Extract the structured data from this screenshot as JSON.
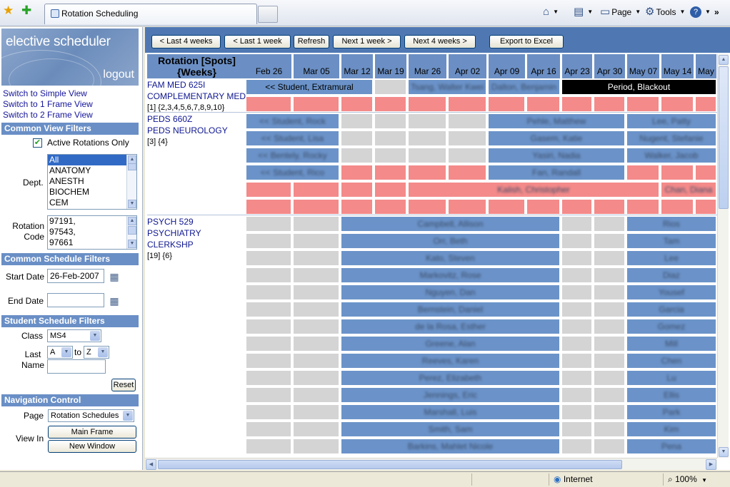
{
  "browser": {
    "tab_title": "Rotation Scheduling",
    "commands": {
      "page": "Page",
      "tools": "Tools"
    }
  },
  "left": {
    "brand_title": "elective scheduler",
    "logout": "logout",
    "links": [
      "Switch to Simple View",
      "Switch to 1 Frame View",
      "Switch to 2 Frame View"
    ],
    "sections": {
      "common_view": "Common View Filters",
      "common_schedule": "Common Schedule Filters",
      "student_schedule": "Student Schedule Filters",
      "navigation": "Navigation Control"
    },
    "active_only_label": "Active Rotations Only",
    "dept_label": "Dept.",
    "dept_options": [
      "All",
      "ANATOMY",
      "ANESTH",
      "BIOCHEM",
      "CEM"
    ],
    "rotation_code_label": "Rotation Code",
    "rotation_codes": [
      "97191,",
      "97543,",
      "97661"
    ],
    "start_date_label": "Start Date",
    "start_date_value": "26-Feb-2007",
    "end_date_label": "End Date",
    "end_date_value": "",
    "class_label": "Class",
    "class_value": "MS4",
    "last_name_label": "Last Name",
    "last_from": "A",
    "to_label": "to",
    "last_to": "Z",
    "reset": "Reset",
    "page_label": "Page",
    "page_value": "Rotation Schedules",
    "view_in_label": "View In",
    "main_frame": "Main Frame",
    "new_window": "New Window"
  },
  "toolbar": {
    "last4": "< Last 4 weeks",
    "last1": "< Last 1 week",
    "refresh": "Refresh",
    "next1": "Next 1 week >",
    "next4": "Next 4 weeks >",
    "export": "Export to Excel"
  },
  "grid": {
    "rotation_header_1": "Rotation [Spots]",
    "rotation_header_2": "{Weeks}",
    "weeks": [
      "Feb 26",
      "Mar 05",
      "Mar 12",
      "Mar 19",
      "Mar 26",
      "Apr 02",
      "Apr 09",
      "Apr 16",
      "Apr 23",
      "Apr 30",
      "May 07",
      "May 14",
      "May"
    ],
    "rotations": [
      {
        "code": "FAM MED 625I",
        "name": "COMPLEMENTARY MED",
        "spots": "[1] {2,3,4,5,6,7,8,9,10}"
      },
      {
        "code": "PEDS 660Z",
        "name": "PEDS NEUROLOGY",
        "spots": "[3] {4}"
      },
      {
        "code": "PSYCH 529",
        "name": "PSYCHIATRY CLERKSHP",
        "spots": "[19] {6}"
      }
    ],
    "labels": {
      "extramural": "<< Student, Extramural",
      "blackout": "Period, Blackout",
      "fam_b1": "Tsang, Walter Kwei",
      "fam_b2": "Dalton, Benjamin",
      "peds_r1_a": "<< Student, Rock",
      "peds_r1_b": "Pehle, Matthew",
      "peds_r1_c": "Lee, Patty",
      "peds_r2_a": "<< Student, Lisa",
      "peds_r2_b": "Gasem, Katie",
      "peds_r2_c": "Nugent, Stefanie",
      "peds_r3_a": "<< Bentely, Rocky",
      "peds_r3_b": "Yasiri, Nadia",
      "peds_r3_c": "Walker, Jacob",
      "peds_r4_a": "<< Student, Rico",
      "peds_r4_b": "Fan, Randall",
      "peds_r5": "Kalish, Christopher",
      "peds_r5_b": "Chan, Diana",
      "psych": [
        "Campbell, Allison",
        "Orr, Beth",
        "Kato, Steven",
        "Markovitz, Rose",
        "Nguyen, Dan",
        "Bernstein, Daniel",
        "de la Rosa, Esther",
        "Greene, Alan",
        "Reeves, Karen",
        "Perez, Elizabeth",
        "Jennings, Eric",
        "Marshall, Luis",
        "Smith, Sam",
        "Barkins, Mahlet Nicole"
      ],
      "psych_right": [
        "Rios",
        "Tam",
        "Lee",
        "Diaz",
        "Yousef",
        "Garcia",
        "Gomez",
        "Mill",
        "Chen",
        "Lu",
        "Ellis",
        "Park",
        "Kim",
        "Pena"
      ]
    }
  },
  "status": {
    "zone": "Internet",
    "zoom": "100%"
  }
}
